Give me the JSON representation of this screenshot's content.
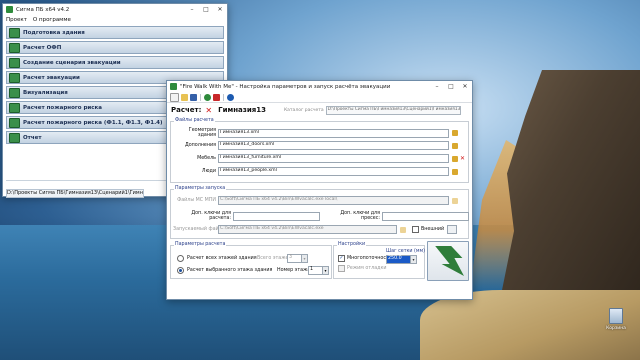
{
  "desktop": {
    "recycle_label": "Корзина"
  },
  "left_window": {
    "title": "Сигма ПБ x64 v4.2",
    "menu": [
      "Проект",
      "О программе"
    ],
    "nav_items": [
      "Подготовка здания",
      "Расчет ОФП",
      "Создание сценария эвакуации",
      "Расчет эвакуации",
      "Визуализация",
      "Расчет пожарного риска",
      "Расчет пожарного риска (Ф1.1, Ф1.3, Ф1.4)",
      "Отчет"
    ],
    "path": "D:\\Проекты Сигма ПБ\\Гимназия13\\Сценарий1\\Гимназия13\\Гимназия13.xml"
  },
  "dialog": {
    "title": "\"Fire Walk With Me\" - Настройка параметров и запуск расчёта эвакуации",
    "calc_label": "Расчет:",
    "calc_name": "Гимназия13",
    "folder_label": "Каталог расчета",
    "folder_value": "D:\\Проекты Сигма ПБ\\Гимназия13\\Сценарий1\\Гимназия13",
    "files_group": "Файлы расчета",
    "files": [
      {
        "label": "Геометрия здания",
        "value": "Гимназия13.xml"
      },
      {
        "label": "Дополнения",
        "value": "Гимназия13_doors.xml"
      },
      {
        "label": "Мебель",
        "value": "Гимназия13_furniture.xml"
      },
      {
        "label": "Люди",
        "value": "Гимназия13_people.xml"
      }
    ],
    "launch_group": "Параметры запуска",
    "exe_label": "Файлы МС МПИ",
    "exe_value": "C:\\Soft\\Сигма ПБ x64 v4.2\\Bin\\EWvacalc.exe local\\",
    "add_keys_label": "Доп. ключи для расчета:",
    "add_keys_run_label": "Доп. ключи для пресес:",
    "run_file_label": "Запускаемый файл",
    "run_file_value": "C:\\Soft\\Сигма ПБ x64 v4.2\\Bin\\EWvacalc.exe",
    "external_label": "Внешний",
    "calc_params_group": "Параметры расчета",
    "radio_all": "Расчет всех этажей здания",
    "radio_selected": "Расчет выбранного этажа здания",
    "floors_total_label": "Всего этажей",
    "floors_total_value": "3",
    "floor_num_label": "Номер этажа",
    "floor_num_value": "1",
    "settings_group": "Настройки",
    "multithread_label": "Многопоточность",
    "smooth_label": "Режим отладки",
    "grid_step_label": "Шаг сетки (мм)",
    "grid_step_value": "250.0"
  },
  "colors": {
    "accent": "#2e8b3c",
    "cancel": "#d01818",
    "nav_text": "#1b2e52"
  }
}
